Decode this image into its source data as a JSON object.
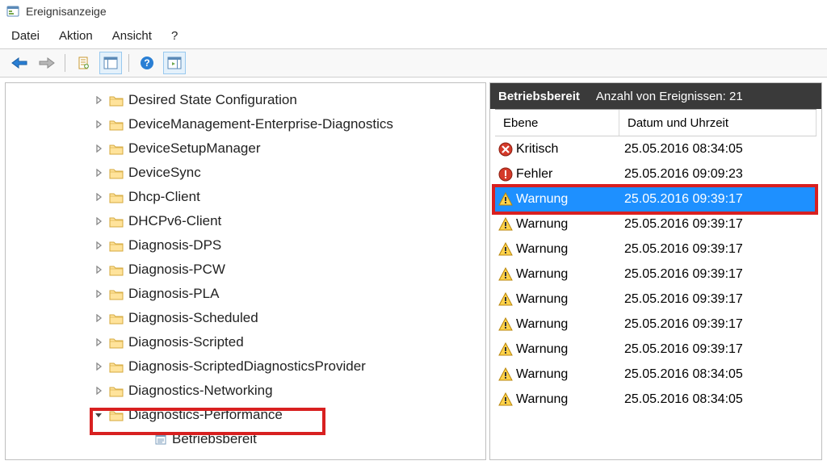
{
  "window": {
    "title": "Ereignisanzeige"
  },
  "menu": {
    "file": "Datei",
    "action": "Aktion",
    "view": "Ansicht",
    "help": "?"
  },
  "tree": {
    "items": [
      {
        "label": "Desired State Configuration",
        "expander": "right"
      },
      {
        "label": "DeviceManagement-Enterprise-Diagnostics",
        "expander": "right"
      },
      {
        "label": "DeviceSetupManager",
        "expander": "right"
      },
      {
        "label": "DeviceSync",
        "expander": "right"
      },
      {
        "label": "Dhcp-Client",
        "expander": "right"
      },
      {
        "label": "DHCPv6-Client",
        "expander": "right"
      },
      {
        "label": "Diagnosis-DPS",
        "expander": "right"
      },
      {
        "label": "Diagnosis-PCW",
        "expander": "right"
      },
      {
        "label": "Diagnosis-PLA",
        "expander": "right"
      },
      {
        "label": "Diagnosis-Scheduled",
        "expander": "right"
      },
      {
        "label": "Diagnosis-Scripted",
        "expander": "right"
      },
      {
        "label": "Diagnosis-ScriptedDiagnosticsProvider",
        "expander": "right"
      },
      {
        "label": "Diagnostics-Networking",
        "expander": "right"
      },
      {
        "label": "Diagnostics-Performance",
        "expander": "down"
      }
    ],
    "child": {
      "label": "Betriebsbereit"
    }
  },
  "events": {
    "header_title": "Betriebsbereit",
    "header_count": "Anzahl von Ereignissen: 21",
    "columns": {
      "level": "Ebene",
      "date": "Datum und Uhrzeit"
    },
    "rows": [
      {
        "level": "Kritisch",
        "date": "25.05.2016 08:34:05",
        "icon": "critical"
      },
      {
        "level": "Fehler",
        "date": "25.05.2016 09:09:23",
        "icon": "error"
      },
      {
        "level": "Warnung",
        "date": "25.05.2016 09:39:17",
        "icon": "warning",
        "selected": true
      },
      {
        "level": "Warnung",
        "date": "25.05.2016 09:39:17",
        "icon": "warning"
      },
      {
        "level": "Warnung",
        "date": "25.05.2016 09:39:17",
        "icon": "warning"
      },
      {
        "level": "Warnung",
        "date": "25.05.2016 09:39:17",
        "icon": "warning"
      },
      {
        "level": "Warnung",
        "date": "25.05.2016 09:39:17",
        "icon": "warning"
      },
      {
        "level": "Warnung",
        "date": "25.05.2016 09:39:17",
        "icon": "warning"
      },
      {
        "level": "Warnung",
        "date": "25.05.2016 09:39:17",
        "icon": "warning"
      },
      {
        "level": "Warnung",
        "date": "25.05.2016 08:34:05",
        "icon": "warning"
      },
      {
        "level": "Warnung",
        "date": "25.05.2016 08:34:05",
        "icon": "warning"
      }
    ]
  }
}
